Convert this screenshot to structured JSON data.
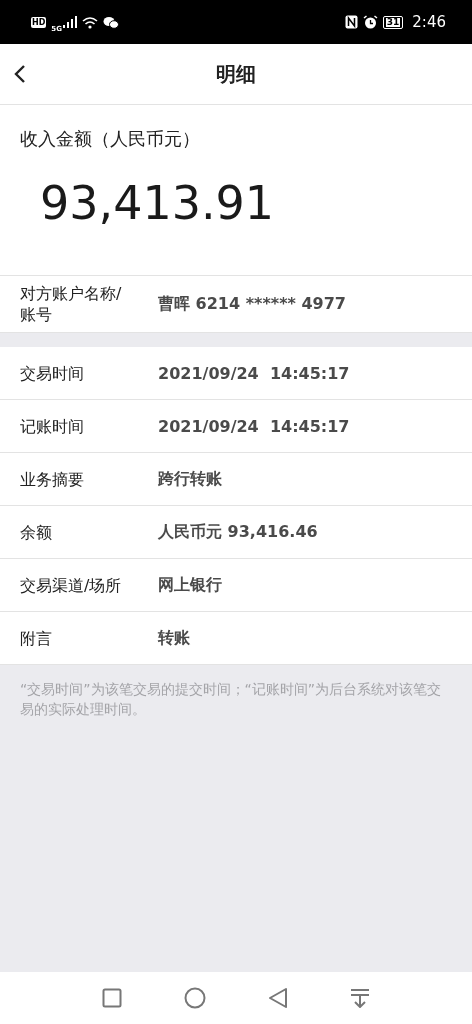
{
  "status_bar": {
    "hd": "HD",
    "network": "5G",
    "battery": "31",
    "time": "2:46"
  },
  "header": {
    "title": "明细"
  },
  "amount": {
    "label": "收入金额（人民币元）",
    "value": "93,413.91"
  },
  "counterparty": {
    "label": "对方账户名称/账号",
    "value": "曹晖 6214 ****** 4977"
  },
  "details": [
    {
      "label": "交易时间",
      "value": "2021/09/24  14:45:17"
    },
    {
      "label": "记账时间",
      "value": "2021/09/24  14:45:17"
    },
    {
      "label": "业务摘要",
      "value": "跨行转账"
    },
    {
      "label": "余额",
      "value": "人民币元 93,416.46"
    },
    {
      "label": "交易渠道/场所",
      "value": "网上银行"
    },
    {
      "label": "附言",
      "value": "转账"
    }
  ],
  "note": "“交易时间”为该笔交易的提交时间；“记账时间”为后台系统对该笔交易的实际处理时间。"
}
